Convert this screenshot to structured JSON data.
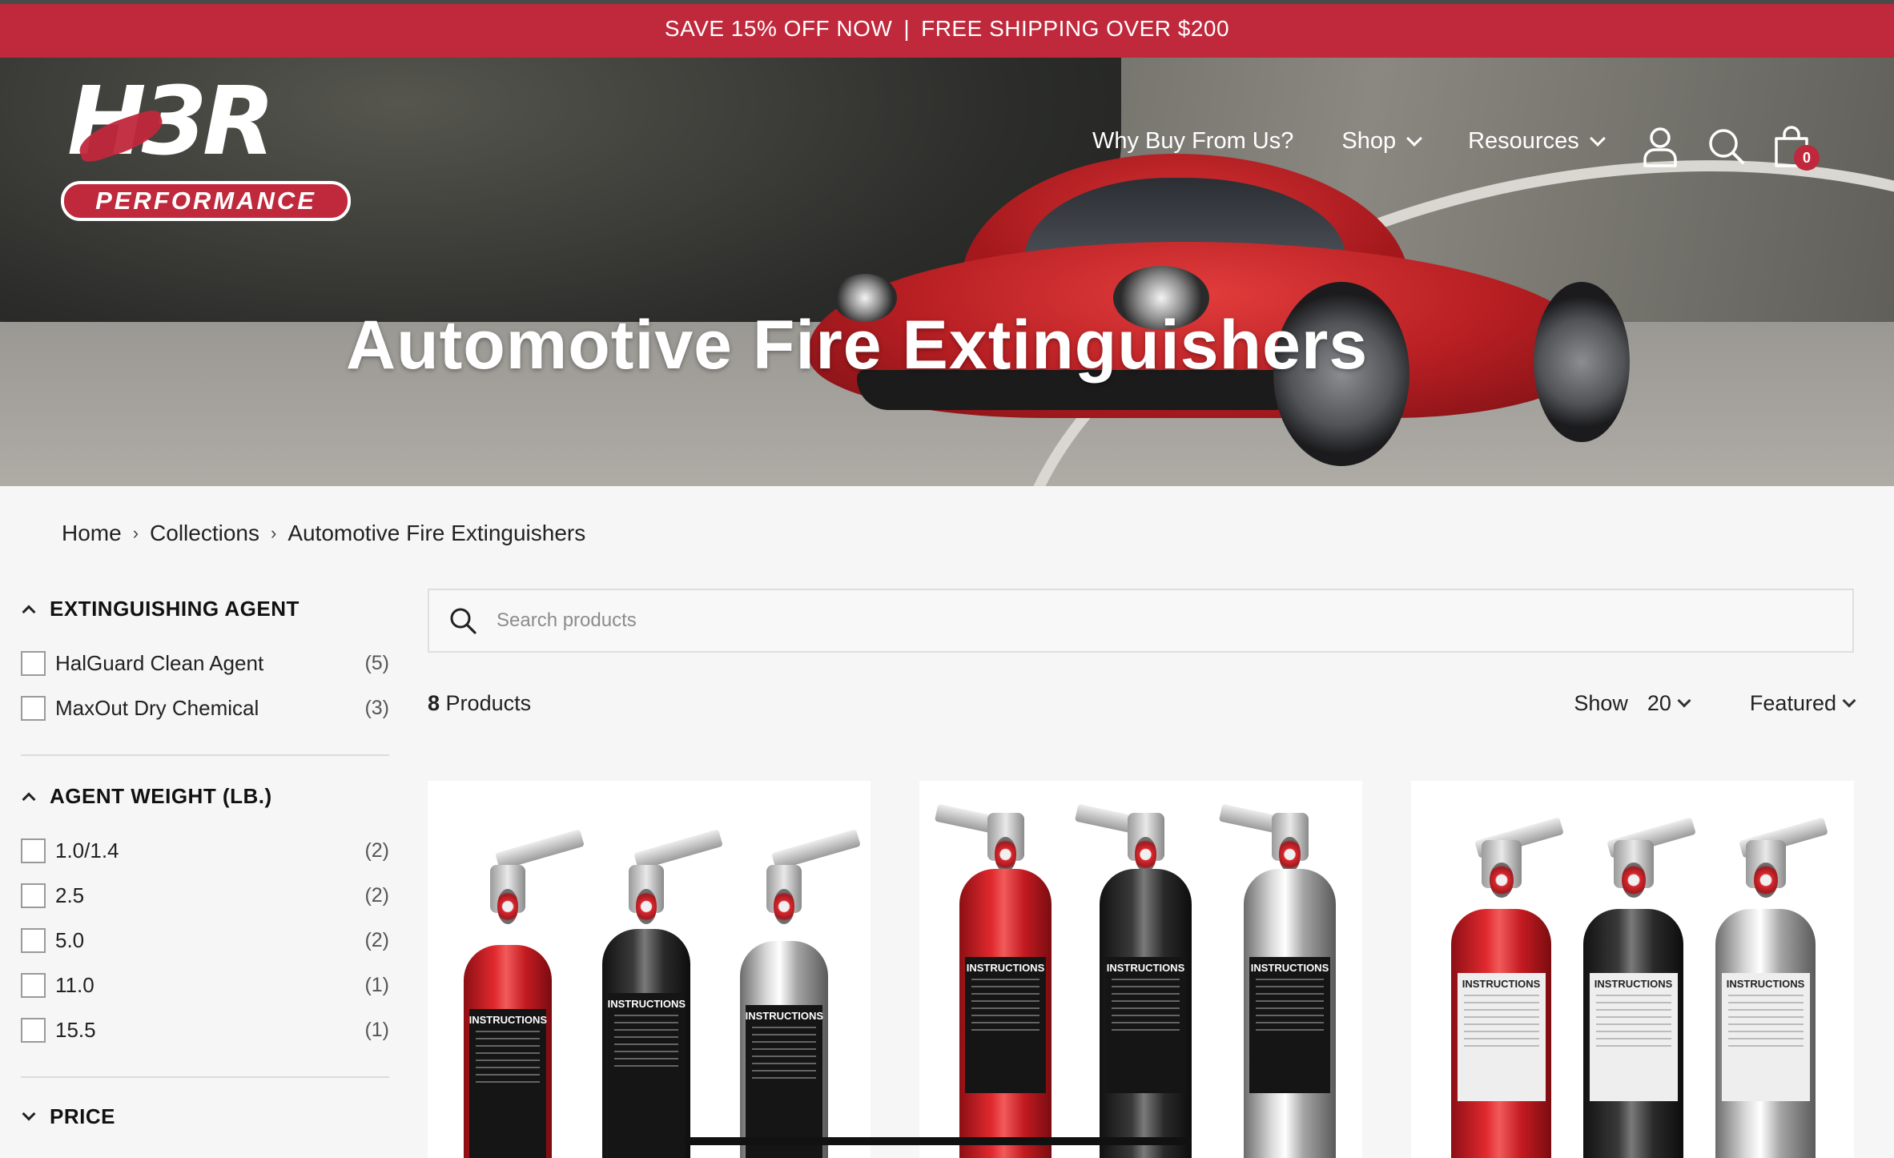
{
  "promo": {
    "left": "SAVE 15% OFF NOW",
    "separator": "|",
    "right": "FREE SHIPPING OVER $200"
  },
  "brand": {
    "wordmark": "H3R",
    "tagline": "PERFORMANCE",
    "accent_color": "#c0283b"
  },
  "nav": {
    "items": [
      {
        "label": "Why Buy From Us?",
        "dropdown": false
      },
      {
        "label": "Shop",
        "dropdown": true
      },
      {
        "label": "Resources",
        "dropdown": true
      }
    ],
    "icons": [
      "account-icon",
      "search-icon",
      "cart-icon"
    ],
    "cart_count": "0"
  },
  "hero": {
    "title": "Automotive Fire Extinguishers"
  },
  "breadcrumb": {
    "items": [
      "Home",
      "Collections",
      "Automotive Fire Extinguishers"
    ],
    "separator": "›"
  },
  "filters": {
    "agent": {
      "title": "EXTINGUISHING AGENT",
      "options": [
        {
          "label": "HalGuard Clean Agent",
          "count": "(5)"
        },
        {
          "label": "MaxOut Dry Chemical",
          "count": "(3)"
        }
      ]
    },
    "weight": {
      "title": "AGENT WEIGHT (LB.)",
      "options": [
        {
          "label": "1.0/1.4",
          "count": "(2)"
        },
        {
          "label": "2.5",
          "count": "(2)"
        },
        {
          "label": "5.0",
          "count": "(2)"
        },
        {
          "label": "11.0",
          "count": "(1)"
        },
        {
          "label": "15.5",
          "count": "(1)"
        }
      ]
    },
    "price": {
      "title": "PRICE"
    }
  },
  "search": {
    "placeholder": "Search products"
  },
  "toolbar": {
    "count_number": "8",
    "count_label": "Products",
    "show_label": "Show",
    "show_value": "20",
    "sort_value": "Featured"
  },
  "product_images": {
    "card1": {
      "label_text": "INSTRUCTIONS",
      "finishes": [
        "red",
        "black",
        "chrome"
      ]
    },
    "card2": {
      "label_text": "INSTRUCTIONS",
      "finishes": [
        "red",
        "black",
        "chrome"
      ]
    },
    "card3": {
      "label_text": "INSTRUCTIONS",
      "finishes": [
        "red",
        "black",
        "chrome"
      ]
    }
  }
}
